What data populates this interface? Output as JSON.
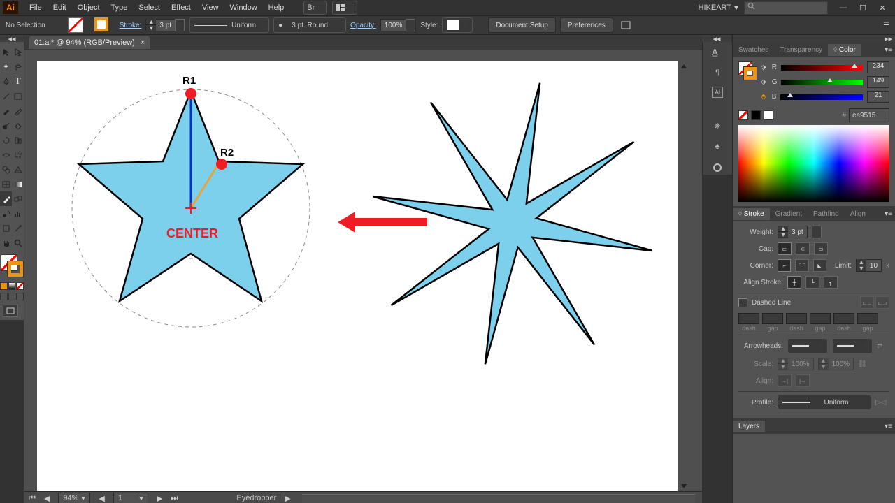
{
  "menu": {
    "items": [
      "File",
      "Edit",
      "Object",
      "Type",
      "Select",
      "Effect",
      "View",
      "Window",
      "Help"
    ]
  },
  "user": "HIKEART",
  "search_placeholder": "",
  "control": {
    "selection_status": "No Selection",
    "stroke_label": "Stroke:",
    "stroke_weight": "3 pt",
    "brush": "Uniform",
    "brush_pt": "3 pt. Round",
    "opacity_label": "Opacity:",
    "opacity": "100%",
    "style_label": "Style:",
    "doc_setup": "Document Setup",
    "prefs": "Preferences"
  },
  "document": {
    "tab": "01.ai* @ 94% (RGB/Preview)"
  },
  "canvas": {
    "r1_label": "R1",
    "r2_label": "R2",
    "center_label": "CENTER"
  },
  "status": {
    "zoom": "94%",
    "page": "1",
    "tool": "Eyedropper"
  },
  "color_panel": {
    "tabs": [
      "Swatches",
      "Transparency",
      "Color"
    ],
    "r": 234,
    "g": 149,
    "b": 21,
    "r_label": "R",
    "g_label": "G",
    "b_label": "B",
    "hex": "ea9515"
  },
  "stroke_panel": {
    "tabs": [
      "Stroke",
      "Gradient",
      "Pathfind",
      "Align"
    ],
    "weight_label": "Weight:",
    "weight_value": "3 pt",
    "cap_label": "Cap:",
    "corner_label": "Corner:",
    "limit_label": "Limit:",
    "limit_value": "10",
    "align_label": "Align Stroke:",
    "dashed_label": "Dashed Line",
    "dash": "dash",
    "gap": "gap",
    "arrowheads_label": "Arrowheads:",
    "scale_label": "Scale:",
    "scale_a": "100%",
    "scale_b": "100%",
    "align_arrow_label": "Align:",
    "profile_label": "Profile:",
    "profile_value": "Uniform"
  },
  "layers_panel": {
    "title": "Layers"
  }
}
